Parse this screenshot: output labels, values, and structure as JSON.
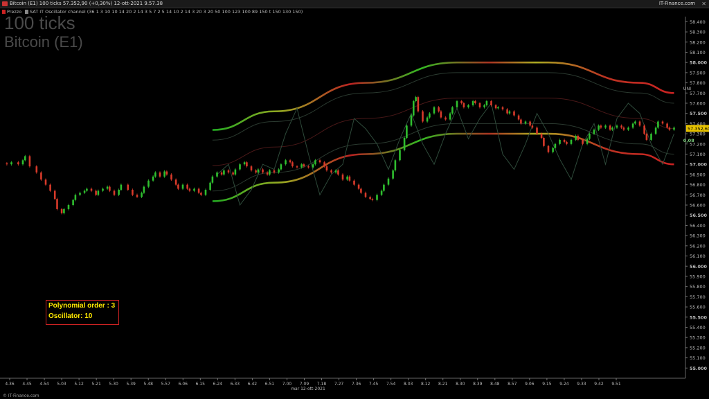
{
  "window": {
    "title": "Bitcoin (E1) 100 ticks 57.352,90 (+0,30%) 12-ott-2021 9.57.38",
    "brand": "IT-Finance.com",
    "close_glyph": "✕"
  },
  "legend": {
    "price_label": "Prezzo",
    "indicator_label": "SAT IT Oscillator channel (36 1 3 10 10 14 20 2 14 3 5 7 2 5 14 10 2 14 3 20 3 20 50 100 123 100 89 150 t 150 130 150)",
    "price_color": "#cc2222",
    "indicator_color": "#888888"
  },
  "header": {
    "timeframe": "100 ticks",
    "instrument": "Bitcoin (E1)"
  },
  "infobox": {
    "line1": "Polynomial order : 3",
    "line2": "Oscillator: 10"
  },
  "footer": {
    "copyright": "© IT-Finance.com"
  },
  "chart_data": {
    "type": "candlestick",
    "y_axis": {
      "ylim": [
        54.9,
        58.45
      ],
      "ticks": [
        "58.400",
        "58.300",
        "58.200",
        "58.100",
        "58.000",
        "57.900",
        "57.800",
        "57.700",
        "57.600",
        "57.500",
        "57.400",
        "57.300",
        "57.200",
        "57.100",
        "57.000",
        "56.900",
        "56.800",
        "56.700",
        "56.600",
        "56.500",
        "56.400",
        "56.300",
        "56.200",
        "56.100",
        "56.000",
        "55.900",
        "55.800",
        "55.700",
        "55.600",
        "55.500",
        "55.400",
        "55.300",
        "55.200",
        "55.100",
        "55.000"
      ],
      "tick_values": [
        58.4,
        58.3,
        58.2,
        58.1,
        58.0,
        57.9,
        57.8,
        57.7,
        57.6,
        57.5,
        57.4,
        57.3,
        57.2,
        57.1,
        57.0,
        56.9,
        56.8,
        56.7,
        56.6,
        56.5,
        56.4,
        56.3,
        56.2,
        56.1,
        56.0,
        55.9,
        55.8,
        55.7,
        55.6,
        55.5,
        55.4,
        55.3,
        55.2,
        55.1,
        55.0
      ],
      "bold_ticks": [
        "58.000",
        "57.500",
        "57.000",
        "56.500",
        "56.000",
        "55.500",
        "55.000"
      ],
      "last_price_label": "57.352,60",
      "last_price": 57.3526
    },
    "x_axis": {
      "ticks": [
        "4.36",
        "4.45",
        "4.54",
        "5.03",
        "5.12",
        "5.21",
        "5.30",
        "5.39",
        "5.48",
        "5.57",
        "6.06",
        "6.15",
        "6.24",
        "6.33",
        "6.42",
        "6.51",
        "7.00",
        "7.09",
        "7.18",
        "7.27",
        "7.36",
        "7.45",
        "7.54",
        "8.03",
        "8.12",
        "8.21",
        "8.30",
        "8.39",
        "8.48",
        "8.57",
        "9.06",
        "9.15",
        "9.24",
        "9.33",
        "9.42",
        "9.51"
      ],
      "date_label": "mar 12-ott-2021"
    },
    "price_path": [
      [
        0,
        57.01
      ],
      [
        3,
        57.0
      ],
      [
        5,
        57.02
      ],
      [
        8,
        57.0
      ],
      [
        10,
        57.04
      ],
      [
        11,
        57.08
      ],
      [
        13,
        56.98
      ],
      [
        16,
        56.92
      ],
      [
        18,
        56.85
      ],
      [
        20,
        56.8
      ],
      [
        22,
        56.74
      ],
      [
        24,
        56.66
      ],
      [
        25,
        56.56
      ],
      [
        27,
        56.52
      ],
      [
        28,
        56.56
      ],
      [
        30,
        56.6
      ],
      [
        32,
        56.65
      ],
      [
        33,
        56.7
      ],
      [
        35,
        56.72
      ],
      [
        37,
        56.74
      ],
      [
        38,
        56.76
      ],
      [
        40,
        56.74
      ],
      [
        42,
        56.7
      ],
      [
        43,
        56.74
      ],
      [
        45,
        56.76
      ],
      [
        47,
        56.78
      ],
      [
        48,
        56.74
      ],
      [
        50,
        56.7
      ],
      [
        52,
        56.75
      ],
      [
        53,
        56.8
      ],
      [
        56,
        56.75
      ],
      [
        58,
        56.7
      ],
      [
        60,
        56.68
      ],
      [
        62,
        56.72
      ],
      [
        63,
        56.78
      ],
      [
        65,
        56.84
      ],
      [
        67,
        56.88
      ],
      [
        68,
        56.92
      ],
      [
        70,
        56.88
      ],
      [
        72,
        56.93
      ],
      [
        73,
        56.9
      ],
      [
        75,
        56.85
      ],
      [
        77,
        56.8
      ],
      [
        78,
        56.76
      ],
      [
        80,
        56.8
      ],
      [
        82,
        56.76
      ],
      [
        83,
        56.74
      ],
      [
        85,
        56.76
      ],
      [
        87,
        56.72
      ],
      [
        88,
        56.7
      ],
      [
        90,
        56.75
      ],
      [
        92,
        56.82
      ],
      [
        93,
        56.88
      ],
      [
        95,
        56.92
      ],
      [
        97,
        56.9
      ],
      [
        98,
        56.94
      ],
      [
        100,
        56.92
      ],
      [
        102,
        56.9
      ],
      [
        103,
        56.95
      ],
      [
        105,
        57.0
      ],
      [
        107,
        57.02
      ],
      [
        108,
        56.98
      ],
      [
        110,
        56.94
      ],
      [
        112,
        56.92
      ],
      [
        113,
        56.95
      ],
      [
        115,
        56.92
      ],
      [
        117,
        56.9
      ],
      [
        118,
        56.94
      ],
      [
        120,
        56.92
      ],
      [
        122,
        56.95
      ],
      [
        123,
        57.0
      ],
      [
        125,
        57.04
      ],
      [
        127,
        57.02
      ],
      [
        128,
        56.98
      ],
      [
        130,
        56.97
      ],
      [
        132,
        57.0
      ],
      [
        133,
        56.98
      ],
      [
        135,
        56.97
      ],
      [
        137,
        57.0
      ],
      [
        138,
        57.04
      ],
      [
        140,
        57.02
      ],
      [
        142,
        56.98
      ],
      [
        143,
        56.94
      ],
      [
        145,
        56.92
      ],
      [
        147,
        56.94
      ],
      [
        148,
        56.9
      ],
      [
        150,
        56.85
      ],
      [
        152,
        56.88
      ],
      [
        153,
        56.84
      ],
      [
        155,
        56.8
      ],
      [
        157,
        56.76
      ],
      [
        158,
        56.72
      ],
      [
        160,
        56.68
      ],
      [
        162,
        56.66
      ],
      [
        163,
        56.65
      ],
      [
        165,
        56.7
      ],
      [
        167,
        56.74
      ],
      [
        168,
        56.8
      ],
      [
        170,
        56.86
      ],
      [
        172,
        56.94
      ],
      [
        173,
        57.04
      ],
      [
        175,
        57.14
      ],
      [
        177,
        57.26
      ],
      [
        178,
        57.38
      ],
      [
        180,
        57.48
      ],
      [
        181,
        57.62
      ],
      [
        182,
        57.66
      ],
      [
        183,
        57.52
      ],
      [
        185,
        57.42
      ],
      [
        187,
        57.46
      ],
      [
        188,
        57.5
      ],
      [
        190,
        57.56
      ],
      [
        192,
        57.52
      ],
      [
        193,
        57.46
      ],
      [
        195,
        57.44
      ],
      [
        197,
        57.5
      ],
      [
        198,
        57.56
      ],
      [
        200,
        57.62
      ],
      [
        202,
        57.6
      ],
      [
        203,
        57.56
      ],
      [
        205,
        57.58
      ],
      [
        207,
        57.62
      ],
      [
        208,
        57.6
      ],
      [
        210,
        57.56
      ],
      [
        212,
        57.58
      ],
      [
        213,
        57.62
      ],
      [
        215,
        57.58
      ],
      [
        217,
        57.55
      ],
      [
        218,
        57.56
      ],
      [
        220,
        57.54
      ],
      [
        222,
        57.5
      ],
      [
        223,
        57.52
      ],
      [
        225,
        57.48
      ],
      [
        227,
        57.44
      ],
      [
        228,
        57.4
      ],
      [
        230,
        57.42
      ],
      [
        232,
        57.38
      ],
      [
        233,
        57.36
      ],
      [
        235,
        57.3
      ],
      [
        237,
        57.26
      ],
      [
        238,
        57.18
      ],
      [
        240,
        57.12
      ],
      [
        242,
        57.16
      ],
      [
        243,
        57.2
      ],
      [
        245,
        57.24
      ],
      [
        247,
        57.22
      ],
      [
        248,
        57.2
      ],
      [
        250,
        57.24
      ],
      [
        252,
        57.28
      ],
      [
        253,
        57.24
      ],
      [
        255,
        57.2
      ],
      [
        257,
        57.25
      ],
      [
        258,
        57.3
      ],
      [
        260,
        57.34
      ],
      [
        262,
        57.38
      ],
      [
        263,
        57.36
      ],
      [
        265,
        57.38
      ],
      [
        267,
        57.34
      ],
      [
        268,
        57.36
      ],
      [
        270,
        57.38
      ],
      [
        272,
        57.36
      ],
      [
        273,
        57.34
      ],
      [
        275,
        57.36
      ],
      [
        277,
        57.4
      ],
      [
        278,
        57.42
      ],
      [
        280,
        57.38
      ],
      [
        282,
        57.3
      ],
      [
        283,
        57.24
      ],
      [
        285,
        57.3
      ],
      [
        287,
        57.36
      ],
      [
        288,
        57.42
      ],
      [
        290,
        57.4
      ],
      [
        292,
        57.36
      ],
      [
        293,
        57.34
      ],
      [
        295,
        57.36
      ]
    ],
    "series": [
      {
        "name": "channel_upper",
        "x": [
          0,
          40,
          80,
          120,
          160,
          200,
          240,
          280,
          295
        ],
        "y": [
          57.1,
          57.1,
          57.25,
          57.52,
          57.8,
          58.0,
          58.0,
          57.8,
          57.7
        ],
        "color_scheme": "red-green gradient"
      },
      {
        "name": "channel_lower",
        "x": [
          0,
          40,
          80,
          120,
          160,
          200,
          240,
          280,
          295
        ],
        "y": [
          56.4,
          56.4,
          56.55,
          56.82,
          57.1,
          57.3,
          57.3,
          57.1,
          57.0
        ],
        "color_scheme": "red-green gradient"
      },
      {
        "name": "inner_upper",
        "x": [
          0,
          40,
          80,
          120,
          160,
          200,
          240,
          280,
          295
        ],
        "y": [
          57.0,
          57.0,
          57.15,
          57.42,
          57.7,
          57.9,
          57.9,
          57.7,
          57.6
        ],
        "color": "#2b3a30"
      },
      {
        "name": "inner_lower",
        "x": [
          0,
          40,
          80,
          120,
          160,
          200,
          240,
          280,
          295
        ],
        "y": [
          56.5,
          56.5,
          56.65,
          56.92,
          57.2,
          57.4,
          57.4,
          57.2,
          57.1
        ],
        "color": "#2b3a30"
      },
      {
        "name": "center",
        "x": [
          0,
          40,
          80,
          120,
          160,
          200,
          240,
          280,
          295
        ],
        "y": [
          56.75,
          56.75,
          56.9,
          57.17,
          57.45,
          57.65,
          57.65,
          57.45,
          57.35
        ],
        "color": "#4a1818"
      }
    ],
    "oscillator": {
      "x": [
        0,
        5,
        10,
        15,
        20,
        25,
        30,
        35,
        40,
        45,
        50,
        55,
        60,
        65,
        70,
        75,
        80,
        85,
        90,
        95,
        100,
        105,
        110,
        115,
        120,
        125,
        130,
        135,
        140,
        145,
        150,
        155,
        160,
        165,
        170,
        175,
        180,
        185,
        190,
        195,
        200,
        205,
        210,
        215,
        220,
        225,
        230,
        235,
        240,
        245,
        250,
        255,
        260,
        265,
        270,
        275,
        280,
        285,
        290,
        295
      ],
      "y": [
        57.0,
        57.2,
        56.9,
        57.1,
        56.85,
        56.8,
        57.2,
        57.35,
        56.9,
        56.8,
        56.95,
        57.3,
        57.0,
        56.8,
        56.75,
        56.95,
        57.05,
        56.7,
        56.65,
        56.9,
        57.0,
        56.6,
        56.75,
        57.0,
        56.95,
        57.3,
        57.55,
        57.1,
        56.7,
        56.9,
        57.0,
        57.45,
        57.35,
        57.2,
        56.95,
        57.25,
        57.5,
        57.2,
        57.0,
        57.3,
        57.55,
        57.25,
        57.45,
        57.6,
        57.1,
        56.95,
        57.2,
        57.5,
        57.3,
        57.05,
        56.85,
        57.2,
        57.4,
        57.0,
        57.45,
        57.6,
        57.5,
        57.2,
        57.0,
        57.3
      ],
      "color": "#2e4a3a"
    },
    "annotations": [
      {
        "text": "UNI",
        "x": 299,
        "y": 57.73
      },
      {
        "text": "0,08",
        "x": 299,
        "y": 57.22
      }
    ]
  }
}
